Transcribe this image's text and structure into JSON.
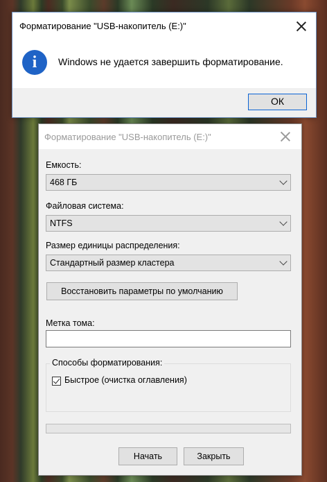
{
  "message_box": {
    "title": "Форматирование \"USB-накопитель (E:)\"",
    "icon_glyph": "i",
    "message": "Windows не удается завершить форматирование.",
    "ok_label": "ОК"
  },
  "format_dialog": {
    "title": "Форматирование \"USB-накопитель (E:)\"",
    "capacity_label": "Емкость:",
    "capacity_value": "468 ГБ",
    "fs_label": "Файловая система:",
    "fs_value": "NTFS",
    "alloc_label": "Размер единицы распределения:",
    "alloc_value": "Стандартный размер кластера",
    "restore_label": "Восстановить параметры по умолчанию",
    "volume_label": "Метка тома:",
    "volume_value": "",
    "options_label": "Способы форматирования:",
    "quick_label": "Быстрое (очистка оглавления)",
    "quick_checked": true,
    "progress": 0,
    "start_label": "Начать",
    "close_label": "Закрыть"
  }
}
